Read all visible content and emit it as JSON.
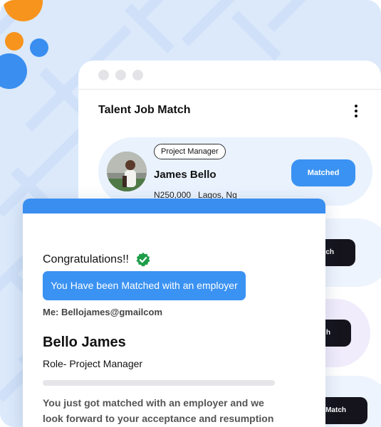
{
  "app": {
    "title": "Talent Job Match"
  },
  "candidate": {
    "role": "Project Manager",
    "name": "James Bello",
    "salary": "N250,000",
    "location": "Lagos, Ng",
    "match_label": "Matched"
  },
  "partial_buttons": [
    {
      "label": "tch"
    },
    {
      "label": "h"
    },
    {
      "label": "Match"
    }
  ],
  "popup": {
    "congrats": "Congratulations!!",
    "banner": "You Have been Matched with an employer",
    "me_line": "Me: Bellojames@gmailcom",
    "name": "Bello James",
    "role_line": "Role- Project Manager",
    "message": "You just got matched with an employer and we look forward to your acceptance and resumption"
  },
  "colors": {
    "accent": "#3a92f2",
    "header": "#3a8ef0",
    "verified": "#1e9e4a",
    "orange": "#f7941d"
  }
}
